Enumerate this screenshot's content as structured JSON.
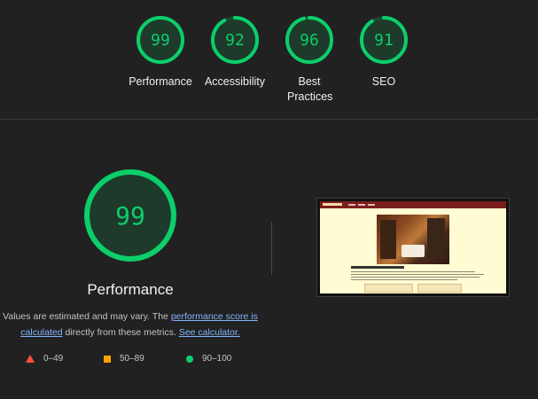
{
  "summary": {
    "categories": [
      {
        "label": "Performance",
        "score": "99",
        "value": 0.99
      },
      {
        "label": "Accessibility",
        "score": "92",
        "value": 0.92
      },
      {
        "label": "Best Practices",
        "score": "96",
        "value": 0.96
      },
      {
        "label": "SEO",
        "score": "91",
        "value": 0.91
      }
    ]
  },
  "performance": {
    "score": "99",
    "value": 0.99,
    "title": "Performance",
    "desc_prefix": "Values are estimated and may vary. The ",
    "link_score": "performance score is calculated",
    "desc_middle": " directly from these metrics. ",
    "link_calculator": "See calculator."
  },
  "legend": {
    "fail": "0–49",
    "average": "50–89",
    "pass": "90–100"
  },
  "colors": {
    "pass": "#0cce6b",
    "average": "#ffa400",
    "fail": "#ff4e42",
    "background": "#212121"
  },
  "icons": {
    "fail": "triangle-icon",
    "average": "square-icon",
    "pass": "circle-icon"
  }
}
